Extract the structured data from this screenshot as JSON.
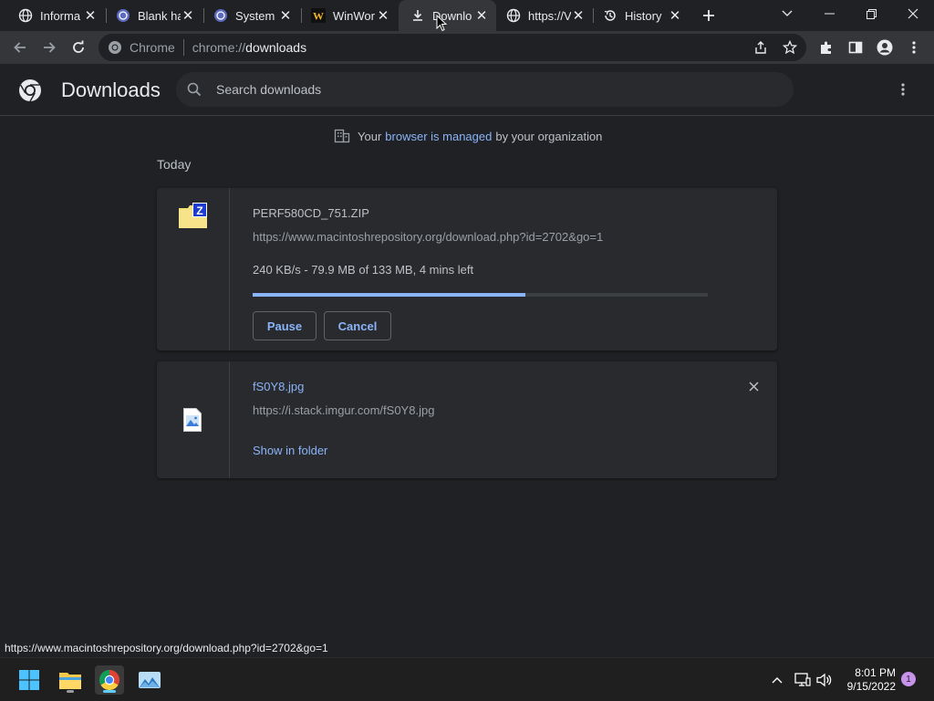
{
  "browser": {
    "tabs": [
      {
        "label": "Informa",
        "icon": "globe-icon"
      },
      {
        "label": "Blank ha",
        "icon": "site-icon"
      },
      {
        "label": "System",
        "icon": "site-icon"
      },
      {
        "label": "WinWor",
        "icon": "winworld-icon"
      },
      {
        "label": "Downlo",
        "icon": "download-icon",
        "active": true
      },
      {
        "label": "https://V",
        "icon": "globe-icon"
      },
      {
        "label": "History",
        "icon": "history-icon"
      }
    ],
    "omnibox": {
      "site_label": "Chrome",
      "url_prefix": "chrome://",
      "url_host": "downloads"
    }
  },
  "page": {
    "title": "Downloads",
    "search_placeholder": "Search downloads",
    "managed_notice": {
      "before": "Your",
      "link": "browser is managed",
      "after": "by your organization"
    },
    "date_header": "Today",
    "downloads": [
      {
        "file_name": "PERF580CD_751.ZIP",
        "url": "https://www.macintoshrepository.org/download.php?id=2702&go=1",
        "status": "240 KB/s - 79.9 MB of 133 MB, 4 mins left",
        "progress": 0.6,
        "pause_label": "Pause",
        "cancel_label": "Cancel",
        "icon": "zip-file-icon"
      },
      {
        "file_name": "fS0Y8.jpg",
        "url": "https://i.stack.imgur.com/fS0Y8.jpg",
        "show_in_folder_label": "Show in folder",
        "remove_label": "✕",
        "icon": "image-file-icon"
      }
    ]
  },
  "status_bar": {
    "text": "https://www.macintoshrepository.org/download.php?id=2702&go=1"
  },
  "taskbar": {
    "time": "8:01 PM",
    "date": "9/15/2022",
    "notification_count": "1"
  },
  "colors": {
    "accent": "#8ab4f8",
    "background": "#202124",
    "card": "#292a2d"
  }
}
